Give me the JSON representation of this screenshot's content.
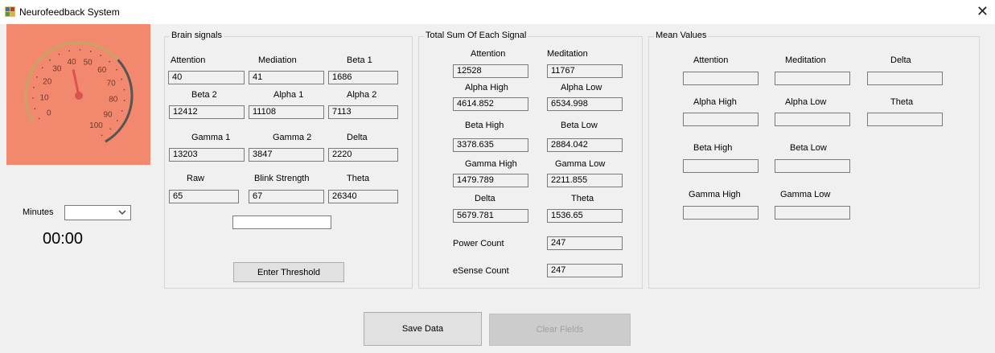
{
  "window": {
    "title": "Neurofeedback System",
    "close": "✕",
    "icon": "app-icon"
  },
  "gauge": {
    "value": 40,
    "min": 0,
    "max": 100,
    "ticks": [
      "0",
      "10",
      "20",
      "30",
      "40",
      "50",
      "60",
      "70",
      "80",
      "90",
      "100"
    ],
    "colors": {
      "panel": "#f2896f",
      "arc_left": "#c8a464",
      "arc_right": "#555555",
      "needle": "#d9534f"
    }
  },
  "timer": {
    "minutes_label": "Minutes",
    "minutes_value": "",
    "display": "00:00"
  },
  "brain": {
    "title": "Brain signals",
    "fields": [
      {
        "label": "Attention",
        "value": "40"
      },
      {
        "label": "Mediation",
        "value": "41"
      },
      {
        "label": "Beta 1",
        "value": "1686"
      },
      {
        "label": "Beta 2",
        "value": "12412"
      },
      {
        "label": "Alpha 1",
        "value": "11108"
      },
      {
        "label": "Alpha 2",
        "value": "7113"
      },
      {
        "label": "Gamma 1",
        "value": "13203"
      },
      {
        "label": "Gamma 2",
        "value": "3847"
      },
      {
        "label": "Delta",
        "value": "2220"
      },
      {
        "label": "Raw",
        "value": "65"
      },
      {
        "label": "Blink Strength",
        "value": "67"
      },
      {
        "label": "Theta",
        "value": "26340"
      }
    ],
    "threshold_value": "",
    "threshold_button": "Enter Threshold"
  },
  "total": {
    "title": "Total Sum Of Each Signal",
    "fields": [
      {
        "label": "Attention",
        "value": "12528"
      },
      {
        "label": "Meditation",
        "value": "11767"
      },
      {
        "label": "Alpha High",
        "value": "4614.852"
      },
      {
        "label": "Alpha Low",
        "value": "6534.998"
      },
      {
        "label": "Beta High",
        "value": "3378.635"
      },
      {
        "label": "Beta Low",
        "value": "2884.042"
      },
      {
        "label": "Gamma High",
        "value": "1479.789"
      },
      {
        "label": "Gamma Low",
        "value": "2211.855"
      },
      {
        "label": "Delta",
        "value": "5679.781"
      },
      {
        "label": "Theta",
        "value": "1536.65"
      }
    ],
    "power_count_label": "Power Count",
    "power_count_value": "247",
    "esense_count_label": "eSense Count",
    "esense_count_value": "247"
  },
  "mean": {
    "title": "Mean Values",
    "fields": [
      {
        "label": "Attention",
        "value": ""
      },
      {
        "label": "Meditation",
        "value": ""
      },
      {
        "label": "Delta",
        "value": ""
      },
      {
        "label": "Alpha High",
        "value": ""
      },
      {
        "label": "Alpha Low",
        "value": ""
      },
      {
        "label": "Theta",
        "value": ""
      },
      {
        "label": "Beta High",
        "value": ""
      },
      {
        "label": "Beta Low",
        "value": ""
      },
      {
        "label": "Gamma High",
        "value": ""
      },
      {
        "label": "Gamma Low",
        "value": ""
      }
    ]
  },
  "buttons": {
    "save": "Save Data",
    "clear": "Clear Fields"
  }
}
